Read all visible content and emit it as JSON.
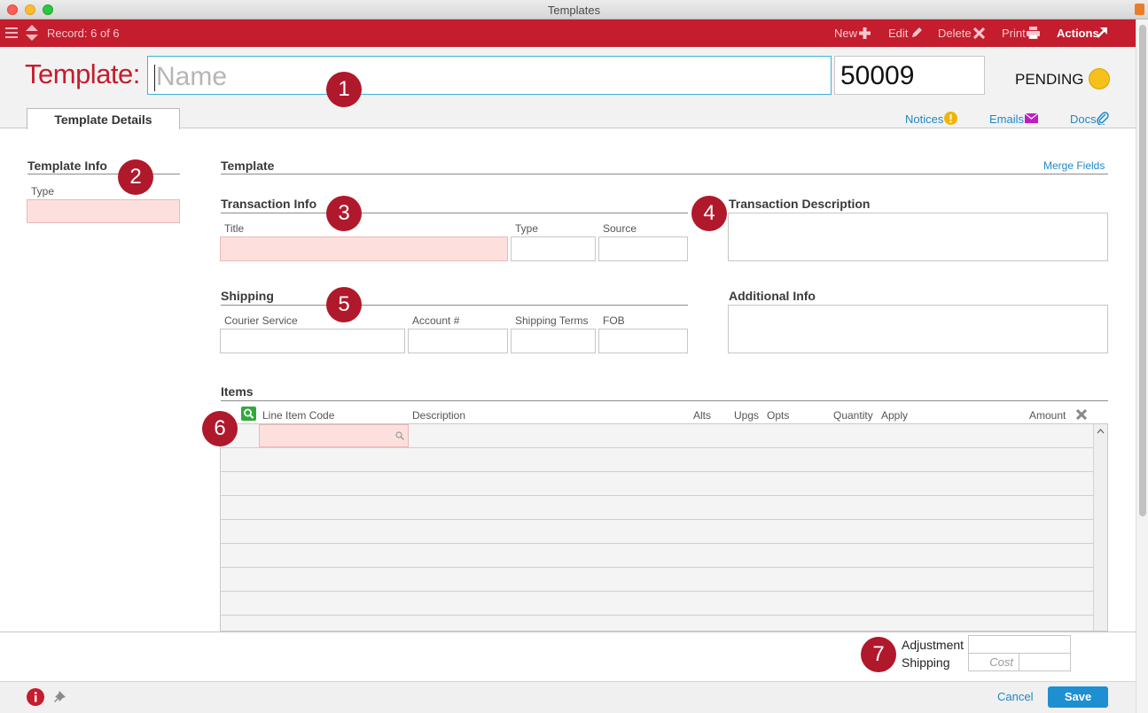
{
  "window": {
    "title": "Templates"
  },
  "toolbar": {
    "record_label": "Record: 6 of 6",
    "new_label": "New",
    "edit_label": "Edit",
    "delete_label": "Delete",
    "print_label": "Print",
    "actions_label": "Actions"
  },
  "header": {
    "template_label": "Template:",
    "name_placeholder": "Name",
    "name_value": "",
    "id_value": "50009",
    "status": "PENDING",
    "status_color": "#f6c11b"
  },
  "tabs": [
    {
      "label": "Template Details"
    }
  ],
  "header_links": {
    "notices": "Notices",
    "emails": "Emails",
    "docs": "Docs"
  },
  "template_info": {
    "title": "Template Info",
    "type_label": "Type"
  },
  "template_section": {
    "title": "Template",
    "merge_fields": "Merge Fields"
  },
  "transaction_info": {
    "title": "Transaction Info",
    "title_label": "Title",
    "type_label": "Type",
    "source_label": "Source"
  },
  "transaction_description": {
    "title": "Transaction Description"
  },
  "shipping": {
    "title": "Shipping",
    "courier_label": "Courier Service",
    "account_label": "Account #",
    "terms_label": "Shipping Terms",
    "fob_label": "FOB"
  },
  "additional_info": {
    "title": "Additional Info"
  },
  "items": {
    "title": "Items",
    "columns": [
      "Line Item Code",
      "Description",
      "Alts",
      "Upgs",
      "Opts",
      "Quantity",
      "Apply",
      "Amount"
    ]
  },
  "totals": {
    "adjustment_label": "Adjustment",
    "shipping_label": "Shipping",
    "cost_placeholder": "Cost"
  },
  "badges": [
    "1",
    "2",
    "3",
    "4",
    "5",
    "6",
    "7"
  ],
  "footer": {
    "cancel_label": "Cancel",
    "save_label": "Save"
  },
  "colors": {
    "brand_red": "#c41d2e",
    "link_blue": "#1e88c8",
    "required_pink": "#fde0de",
    "save_blue": "#1e8fd0"
  }
}
